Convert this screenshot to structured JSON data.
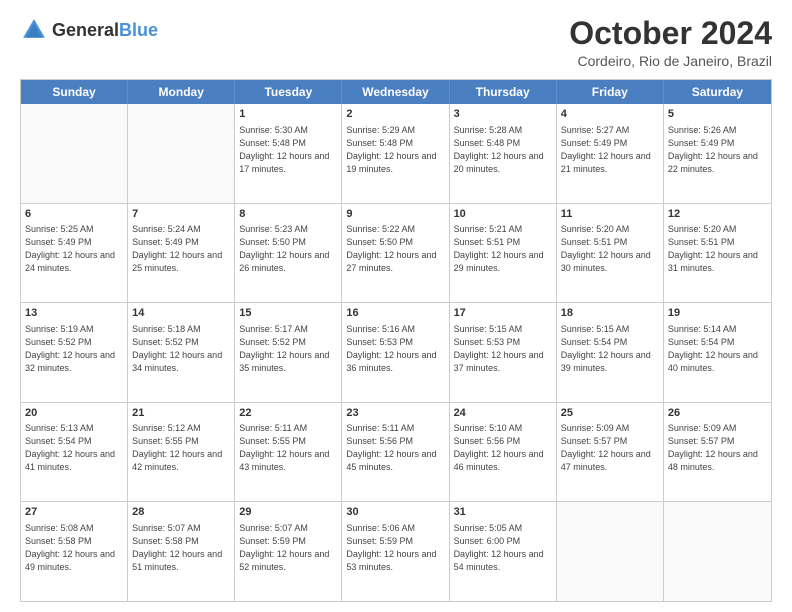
{
  "header": {
    "logo": {
      "general": "General",
      "blue": "Blue",
      "tagline": "GeneralBlue"
    },
    "title": "October 2024",
    "location": "Cordeiro, Rio de Janeiro, Brazil"
  },
  "calendar": {
    "weekdays": [
      "Sunday",
      "Monday",
      "Tuesday",
      "Wednesday",
      "Thursday",
      "Friday",
      "Saturday"
    ],
    "weeks": [
      [
        {
          "day": "",
          "info": ""
        },
        {
          "day": "",
          "info": ""
        },
        {
          "day": "1",
          "info": "Sunrise: 5:30 AM\nSunset: 5:48 PM\nDaylight: 12 hours and 17 minutes."
        },
        {
          "day": "2",
          "info": "Sunrise: 5:29 AM\nSunset: 5:48 PM\nDaylight: 12 hours and 19 minutes."
        },
        {
          "day": "3",
          "info": "Sunrise: 5:28 AM\nSunset: 5:48 PM\nDaylight: 12 hours and 20 minutes."
        },
        {
          "day": "4",
          "info": "Sunrise: 5:27 AM\nSunset: 5:49 PM\nDaylight: 12 hours and 21 minutes."
        },
        {
          "day": "5",
          "info": "Sunrise: 5:26 AM\nSunset: 5:49 PM\nDaylight: 12 hours and 22 minutes."
        }
      ],
      [
        {
          "day": "6",
          "info": "Sunrise: 5:25 AM\nSunset: 5:49 PM\nDaylight: 12 hours and 24 minutes."
        },
        {
          "day": "7",
          "info": "Sunrise: 5:24 AM\nSunset: 5:49 PM\nDaylight: 12 hours and 25 minutes."
        },
        {
          "day": "8",
          "info": "Sunrise: 5:23 AM\nSunset: 5:50 PM\nDaylight: 12 hours and 26 minutes."
        },
        {
          "day": "9",
          "info": "Sunrise: 5:22 AM\nSunset: 5:50 PM\nDaylight: 12 hours and 27 minutes."
        },
        {
          "day": "10",
          "info": "Sunrise: 5:21 AM\nSunset: 5:51 PM\nDaylight: 12 hours and 29 minutes."
        },
        {
          "day": "11",
          "info": "Sunrise: 5:20 AM\nSunset: 5:51 PM\nDaylight: 12 hours and 30 minutes."
        },
        {
          "day": "12",
          "info": "Sunrise: 5:20 AM\nSunset: 5:51 PM\nDaylight: 12 hours and 31 minutes."
        }
      ],
      [
        {
          "day": "13",
          "info": "Sunrise: 5:19 AM\nSunset: 5:52 PM\nDaylight: 12 hours and 32 minutes."
        },
        {
          "day": "14",
          "info": "Sunrise: 5:18 AM\nSunset: 5:52 PM\nDaylight: 12 hours and 34 minutes."
        },
        {
          "day": "15",
          "info": "Sunrise: 5:17 AM\nSunset: 5:52 PM\nDaylight: 12 hours and 35 minutes."
        },
        {
          "day": "16",
          "info": "Sunrise: 5:16 AM\nSunset: 5:53 PM\nDaylight: 12 hours and 36 minutes."
        },
        {
          "day": "17",
          "info": "Sunrise: 5:15 AM\nSunset: 5:53 PM\nDaylight: 12 hours and 37 minutes."
        },
        {
          "day": "18",
          "info": "Sunrise: 5:15 AM\nSunset: 5:54 PM\nDaylight: 12 hours and 39 minutes."
        },
        {
          "day": "19",
          "info": "Sunrise: 5:14 AM\nSunset: 5:54 PM\nDaylight: 12 hours and 40 minutes."
        }
      ],
      [
        {
          "day": "20",
          "info": "Sunrise: 5:13 AM\nSunset: 5:54 PM\nDaylight: 12 hours and 41 minutes."
        },
        {
          "day": "21",
          "info": "Sunrise: 5:12 AM\nSunset: 5:55 PM\nDaylight: 12 hours and 42 minutes."
        },
        {
          "day": "22",
          "info": "Sunrise: 5:11 AM\nSunset: 5:55 PM\nDaylight: 12 hours and 43 minutes."
        },
        {
          "day": "23",
          "info": "Sunrise: 5:11 AM\nSunset: 5:56 PM\nDaylight: 12 hours and 45 minutes."
        },
        {
          "day": "24",
          "info": "Sunrise: 5:10 AM\nSunset: 5:56 PM\nDaylight: 12 hours and 46 minutes."
        },
        {
          "day": "25",
          "info": "Sunrise: 5:09 AM\nSunset: 5:57 PM\nDaylight: 12 hours and 47 minutes."
        },
        {
          "day": "26",
          "info": "Sunrise: 5:09 AM\nSunset: 5:57 PM\nDaylight: 12 hours and 48 minutes."
        }
      ],
      [
        {
          "day": "27",
          "info": "Sunrise: 5:08 AM\nSunset: 5:58 PM\nDaylight: 12 hours and 49 minutes."
        },
        {
          "day": "28",
          "info": "Sunrise: 5:07 AM\nSunset: 5:58 PM\nDaylight: 12 hours and 51 minutes."
        },
        {
          "day": "29",
          "info": "Sunrise: 5:07 AM\nSunset: 5:59 PM\nDaylight: 12 hours and 52 minutes."
        },
        {
          "day": "30",
          "info": "Sunrise: 5:06 AM\nSunset: 5:59 PM\nDaylight: 12 hours and 53 minutes."
        },
        {
          "day": "31",
          "info": "Sunrise: 5:05 AM\nSunset: 6:00 PM\nDaylight: 12 hours and 54 minutes."
        },
        {
          "day": "",
          "info": ""
        },
        {
          "day": "",
          "info": ""
        }
      ]
    ]
  }
}
